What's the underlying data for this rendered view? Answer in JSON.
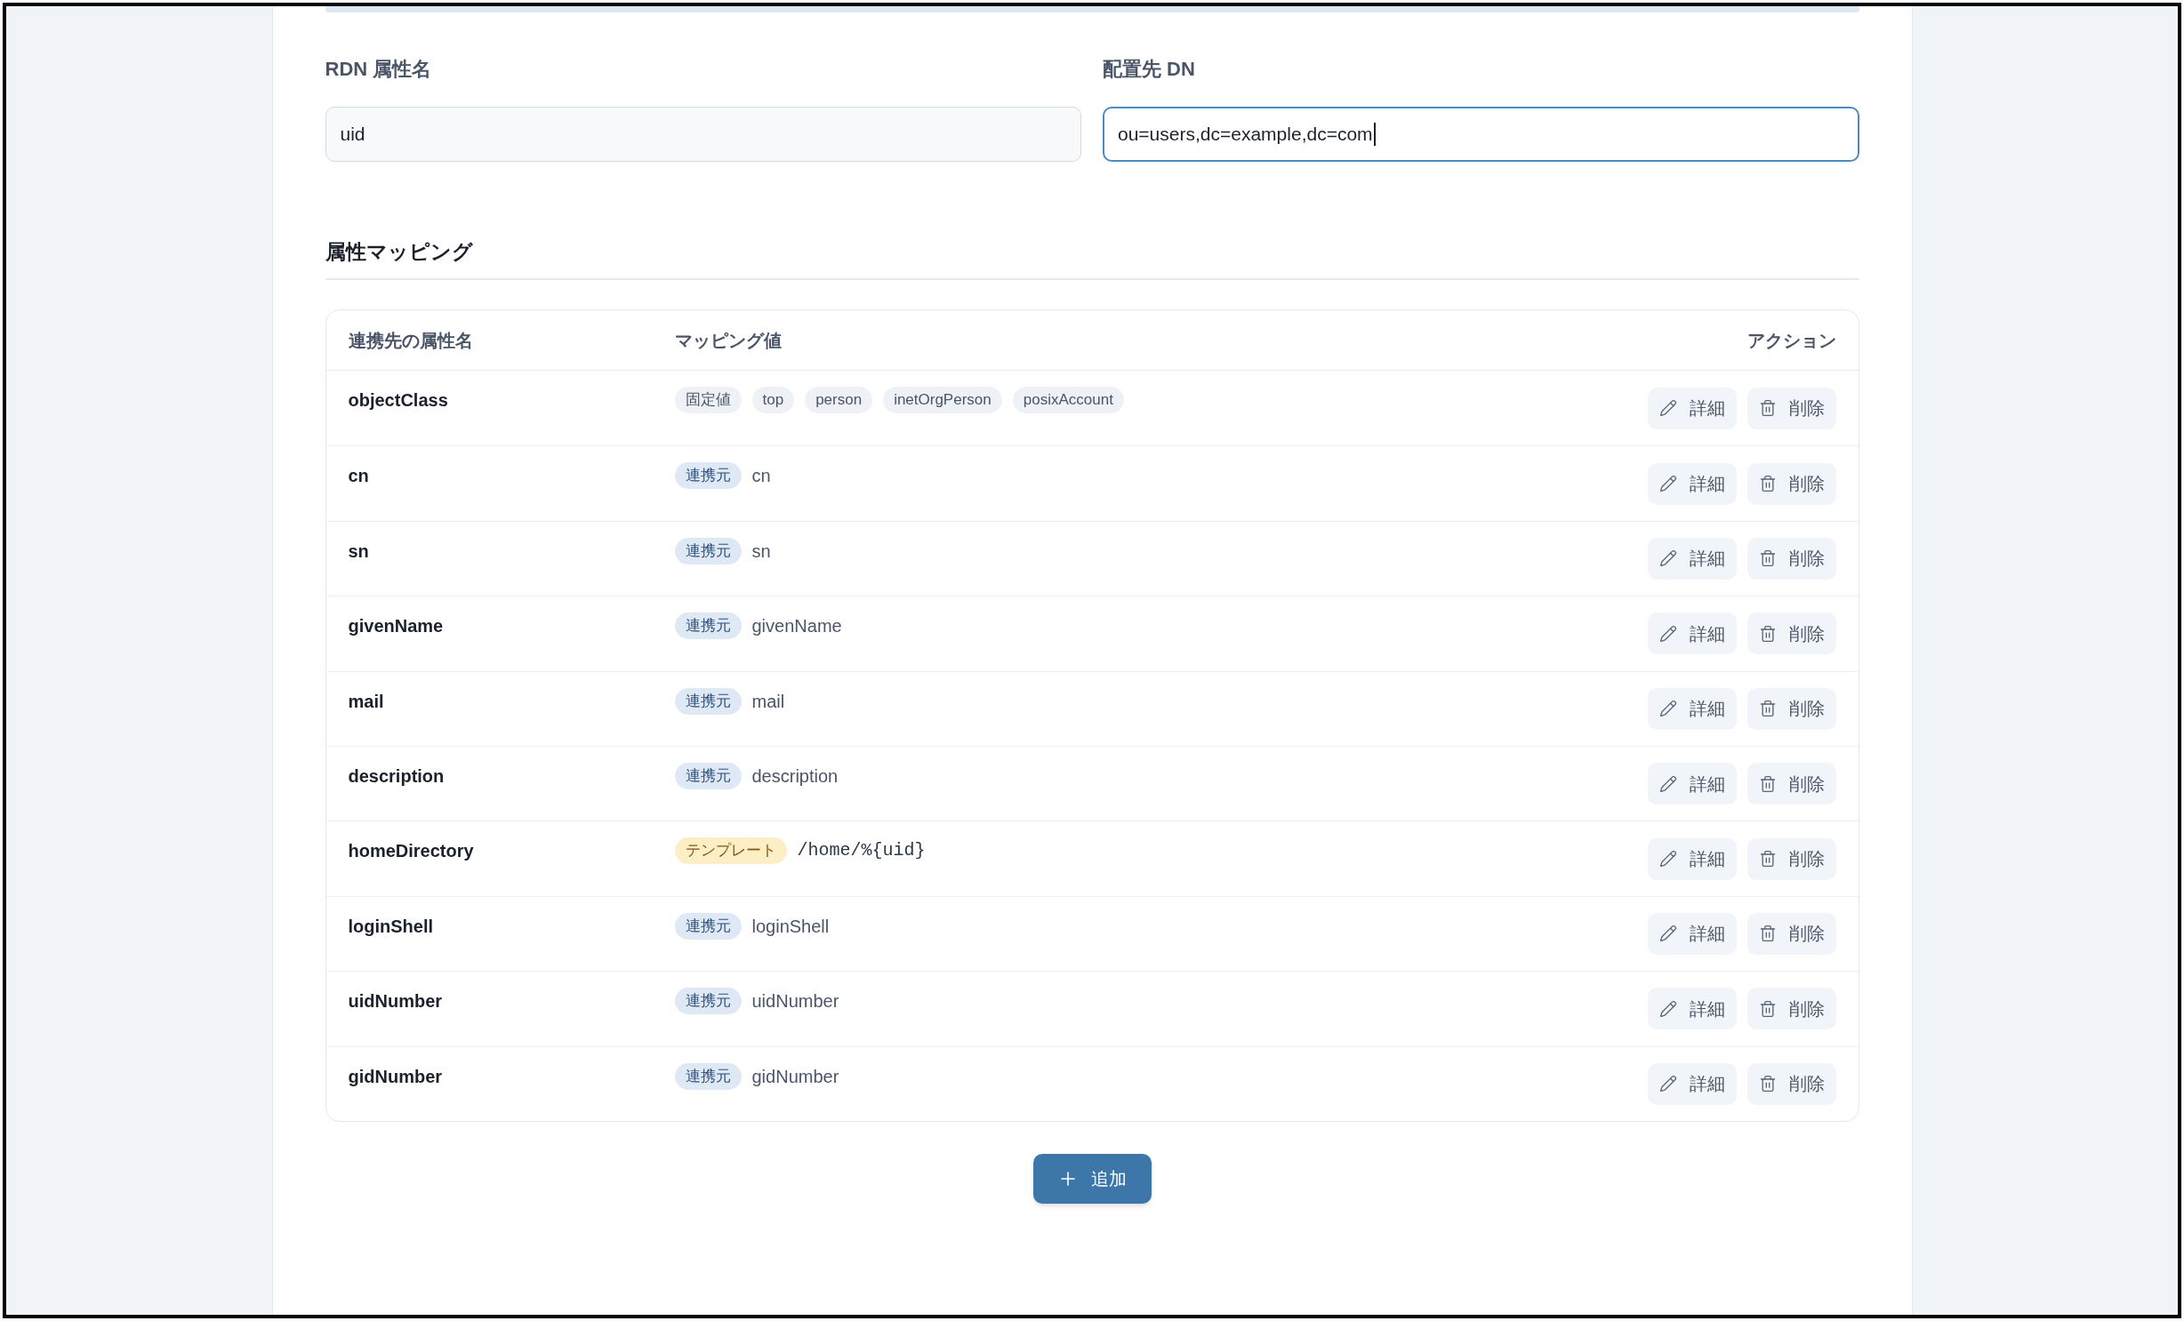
{
  "form": {
    "fields": [
      {
        "label": "RDN 属性名",
        "value": "uid",
        "focused": false
      },
      {
        "label": "配置先 DN",
        "value": "ou=users,dc=example,dc=com",
        "focused": true
      }
    ]
  },
  "mapping_section": {
    "title": "属性マッピング",
    "table": {
      "columns": [
        "連携先の属性名",
        "マッピング値",
        "アクション"
      ],
      "rows": [
        {
          "attribute": "objectClass",
          "mapping": {
            "kind": "fixed",
            "label": "固定値",
            "values": [
              "top",
              "person",
              "inetOrgPerson",
              "posixAccount"
            ]
          },
          "actions": [
            {
              "kind": "edit",
              "label": "詳細"
            },
            {
              "kind": "delete",
              "label": "削除"
            }
          ]
        },
        {
          "attribute": "cn",
          "mapping": {
            "kind": "source",
            "label": "連携元",
            "value": "cn"
          },
          "actions": [
            {
              "kind": "edit",
              "label": "詳細"
            },
            {
              "kind": "delete",
              "label": "削除"
            }
          ]
        },
        {
          "attribute": "sn",
          "mapping": {
            "kind": "source",
            "label": "連携元",
            "value": "sn"
          },
          "actions": [
            {
              "kind": "edit",
              "label": "詳細"
            },
            {
              "kind": "delete",
              "label": "削除"
            }
          ]
        },
        {
          "attribute": "givenName",
          "mapping": {
            "kind": "source",
            "label": "連携元",
            "value": "givenName"
          },
          "actions": [
            {
              "kind": "edit",
              "label": "詳細"
            },
            {
              "kind": "delete",
              "label": "削除"
            }
          ]
        },
        {
          "attribute": "mail",
          "mapping": {
            "kind": "source",
            "label": "連携元",
            "value": "mail"
          },
          "actions": [
            {
              "kind": "edit",
              "label": "詳細"
            },
            {
              "kind": "delete",
              "label": "削除"
            }
          ]
        },
        {
          "attribute": "description",
          "mapping": {
            "kind": "source",
            "label": "連携元",
            "value": "description"
          },
          "actions": [
            {
              "kind": "edit",
              "label": "詳細"
            },
            {
              "kind": "delete",
              "label": "削除"
            }
          ]
        },
        {
          "attribute": "homeDirectory",
          "mapping": {
            "kind": "template",
            "label": "テンプレート",
            "value": "/home/%{uid}"
          },
          "actions": [
            {
              "kind": "edit",
              "label": "詳細"
            },
            {
              "kind": "delete",
              "label": "削除"
            }
          ]
        },
        {
          "attribute": "loginShell",
          "mapping": {
            "kind": "source",
            "label": "連携元",
            "value": "loginShell"
          },
          "actions": [
            {
              "kind": "edit",
              "label": "詳細"
            },
            {
              "kind": "delete",
              "label": "削除"
            }
          ]
        },
        {
          "attribute": "uidNumber",
          "mapping": {
            "kind": "source",
            "label": "連携元",
            "value": "uidNumber"
          },
          "actions": [
            {
              "kind": "edit",
              "label": "詳細"
            },
            {
              "kind": "delete",
              "label": "削除"
            }
          ]
        },
        {
          "attribute": "gidNumber",
          "mapping": {
            "kind": "source",
            "label": "連携元",
            "value": "gidNumber"
          },
          "actions": [
            {
              "kind": "edit",
              "label": "詳細"
            },
            {
              "kind": "delete",
              "label": "削除"
            }
          ]
        }
      ]
    },
    "add_button": {
      "label": "追加"
    }
  }
}
